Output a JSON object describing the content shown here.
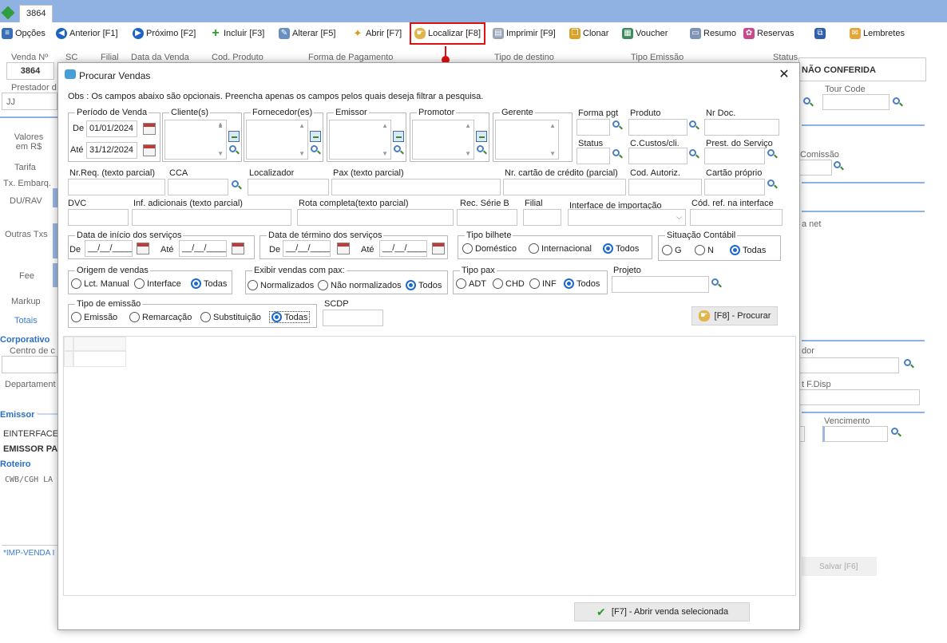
{
  "app": {
    "tab_label": "3864"
  },
  "toolbar": [
    {
      "label": "Opções",
      "icon": "options-icon"
    },
    {
      "label": "Anterior [F1]",
      "icon": "previous-icon"
    },
    {
      "label": "Próximo [F2]",
      "icon": "next-icon"
    },
    {
      "label": "Incluir [F3]",
      "icon": "add-icon"
    },
    {
      "label": "Alterar [F5]",
      "icon": "edit-icon"
    },
    {
      "label": "Abrir [F7]",
      "icon": "open-icon"
    },
    {
      "label": "Localizar [F8]",
      "icon": "search-hand-icon"
    },
    {
      "label": "Imprimir [F9]",
      "icon": "print-icon"
    },
    {
      "label": "Clonar",
      "icon": "clone-icon"
    },
    {
      "label": "Voucher",
      "icon": "voucher-icon"
    },
    {
      "label": "Resumo",
      "icon": "summary-icon"
    },
    {
      "label": "Reservas",
      "icon": "reservations-icon"
    },
    {
      "label": "",
      "icon": "attachment-icon"
    },
    {
      "label": "Lembretes",
      "icon": "reminders-icon"
    }
  ],
  "background": {
    "venda_no_label": "Venda Nº",
    "venda_no": "3864",
    "sc": "SC",
    "filial": "Filial",
    "data_venda": "Data da Venda",
    "cod_produto": "Cod. Produto",
    "forma_pagamento": "Forma de Pagamento",
    "tipo_destino": "Tipo de destino",
    "tipo_emissao": "Tipo Emissão",
    "status_label": "Status",
    "status_value": "NÃO CONFERIDA",
    "prestador": "Prestador d",
    "prestador_val": "JJ",
    "tour_code": "Tour Code",
    "valores": "Valores em R$",
    "tarifa": "Tarifa",
    "tx_embarq": "Tx. Embarq.",
    "du_rav": "DU/RAV",
    "outras_txs": "Outras Txs",
    "fee": "Fee",
    "markup": "Markup",
    "totais": "Totais",
    "corporativo": "Corporativo",
    "centro": "Centro de c",
    "departamento": "Departament",
    "emissor": "Emissor",
    "einterface": "EINTERFACE",
    "emissor_pa": "EMISSOR PA",
    "roteiro": "Roteiro",
    "roteiro_val": "CWB/CGH LA",
    "imp_venda": "*IMP-VENDA I",
    "comissao": "Comissão",
    "net": "a net",
    "dor": "dor",
    "fdisp": "t F.Disp",
    "vencimento": "Vencimento",
    "salvar": "Salvar [F6]"
  },
  "dialog": {
    "title": "Procurar Vendas",
    "obs": "Obs : Os campos abaixo são opcionais. Preencha apenas os campos pelos quais deseja filtrar a pesquisa.",
    "periodo": {
      "legend": "Período de Venda",
      "de_label": "De",
      "de_value": "01/01/2024",
      "ate_label": "Até",
      "ate_value": "31/12/2024"
    },
    "cliente": "Cliente(s)",
    "fornecedor": "Fornecedor(es)",
    "emissor": "Emissor",
    "promotor": "Promotor",
    "gerente": "Gerente",
    "forma_pgt": "Forma pgt",
    "produto": "Produto",
    "nr_doc": "Nr Doc.",
    "status": "Status",
    "ccustos": "C.Custos/cli.",
    "prest_servico": "Prest. do Serviço",
    "nr_req": "Nr.Req. (texto parcial)",
    "cca": "CCA",
    "localizador": "Localizador",
    "pax": "Pax (texto parcial)",
    "nr_cartao": "Nr. cartão de crédito (parcial)",
    "cod_autoriz": "Cod. Autoriz.",
    "cartao_proprio": "Cartão próprio",
    "dvc": "DVC",
    "inf_adicionais": "Inf. adicionais (texto parcial)",
    "rota_completa": "Rota completa(texto parcial)",
    "rec_serie": "Rec. Série B",
    "filial": "Filial",
    "interface_importacao": "Interface de importação",
    "cod_ref": "Cód. ref. na interface",
    "inicio_servicos": {
      "legend": "Data de início dos serviços",
      "de_label": "De",
      "de_value": "__/__/____",
      "ate_label": "Até",
      "ate_value": "__/__/____"
    },
    "termino_servicos": {
      "legend": "Data de término dos serviços",
      "de_label": "De",
      "de_value": "__/__/____",
      "ate_label": "Até",
      "ate_value": "__/__/____"
    },
    "tipo_bilhete": {
      "legend": "Tipo bilhete",
      "options": [
        "Doméstico",
        "Internacional",
        "Todos"
      ]
    },
    "situacao_contabil": {
      "legend": "Situação Contábil",
      "options": [
        "G",
        "N",
        "Todas"
      ]
    },
    "origem_vendas": {
      "legend": "Origem de vendas",
      "options": [
        "Lct. Manual",
        "Interface",
        "Todas"
      ]
    },
    "exibir_vendas": {
      "legend": "Exibir vendas com pax:",
      "options": [
        "Normalizados",
        "Não normalizados",
        "Todos"
      ]
    },
    "tipo_pax": {
      "legend": "Tipo pax",
      "options": [
        "ADT",
        "CHD",
        "INF",
        "Todos"
      ]
    },
    "projeto": "Projeto",
    "tipo_emissao": {
      "legend": "Tipo de emissão",
      "options": [
        "Emissão",
        "Remarcação",
        "Substituição",
        "Todas"
      ]
    },
    "scdp": "SCDP",
    "procurar_button": "[F8] - Procurar",
    "abrir_button": "[F7] - Abrir venda selecionada"
  }
}
